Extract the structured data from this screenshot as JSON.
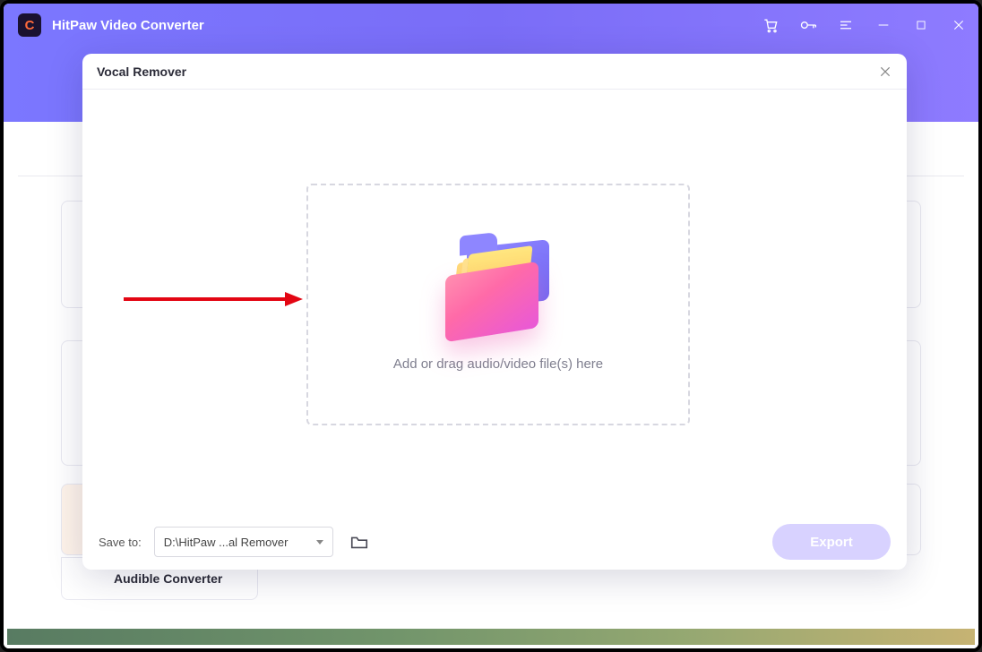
{
  "app": {
    "title": "HitPaw Video Converter"
  },
  "modal": {
    "title": "Vocal Remover",
    "drop_text": "Add or drag audio/video file(s) here",
    "save_label": "Save to:",
    "save_path": "D:\\HitPaw ...al Remover",
    "export_label": "Export"
  },
  "background": {
    "audible_card_label": "Audible Converter"
  },
  "icons": {
    "cart": "cart-icon",
    "key": "key-icon",
    "menu": "menu-icon",
    "minimize": "minimize-icon",
    "maximize": "maximize-icon",
    "close": "close-icon"
  }
}
